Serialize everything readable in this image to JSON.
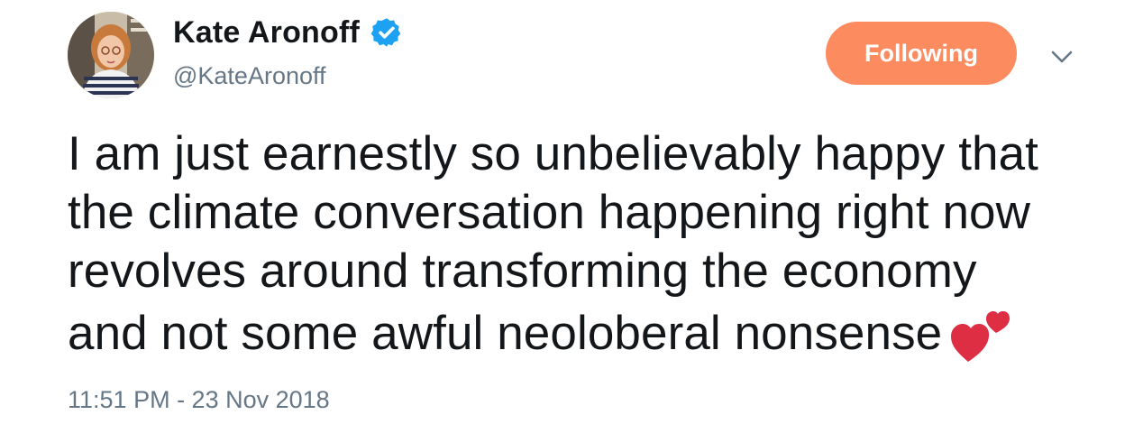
{
  "author": {
    "display_name": "Kate Aronoff",
    "handle": "@KateAronoff",
    "verified": true
  },
  "follow_button": {
    "label": "Following",
    "color": "#fc8c60"
  },
  "tweet": {
    "lines": [
      "I am just earnestly so unbelievably happy that",
      "the climate conversation happening right now",
      "revolves around transforming the economy",
      "and not some awful neoloberal nonsense"
    ],
    "emoji": "two-hearts-icon",
    "timestamp": "11:51 PM - 23 Nov 2018"
  },
  "colors": {
    "text": "#14171a",
    "secondary": "#657786",
    "verified_badge": "#1da1f2",
    "heart": "#dd2e44"
  }
}
